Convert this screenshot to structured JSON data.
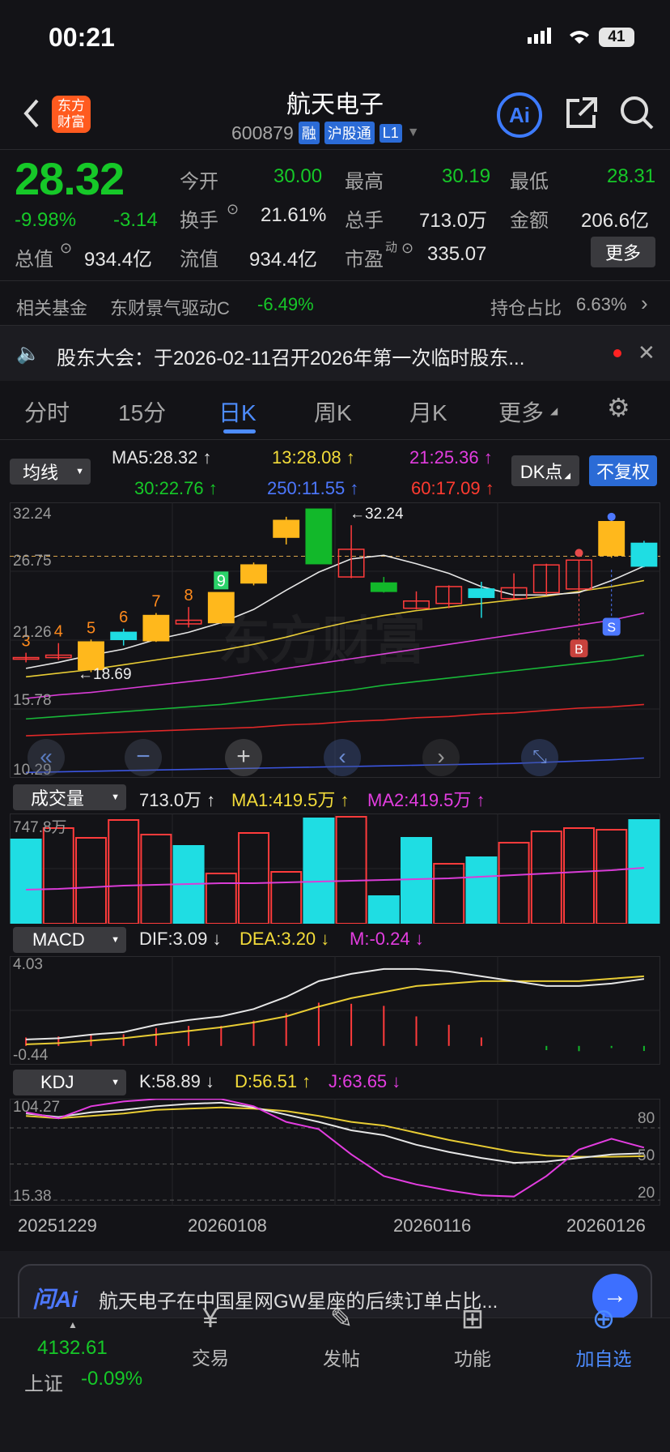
{
  "status": {
    "time": "00:21",
    "battery": "41"
  },
  "header": {
    "logo": "东方\n财富",
    "title": "航天电子",
    "code": "600879",
    "tags": [
      "融",
      "沪股通",
      "L1"
    ],
    "ai": "Ai"
  },
  "quote": {
    "price": "28.32",
    "change_pct": "-9.98%",
    "change": "-3.14",
    "open_label": "今开",
    "open": "30.00",
    "high_label": "最高",
    "high": "30.19",
    "low_label": "最低",
    "low": "28.31",
    "turnover_label": "换手",
    "turnover": "21.61%",
    "vol_label": "总手",
    "vol": "713.0万",
    "amount_label": "金额",
    "amount": "206.6亿",
    "mcap_label": "总值",
    "mcap": "934.4亿",
    "float_label": "流值",
    "float": "934.4亿",
    "pe_label": "市盈",
    "pe_sup": "动",
    "pe": "335.07",
    "more": "更多"
  },
  "fund": {
    "label": "相关基金",
    "name": "东财景气驱动C",
    "pct": "-6.49%",
    "hold_label": "持仓占比",
    "hold": "6.63%"
  },
  "notice": {
    "text": "股东大会：于2026-02-11召开2026年第一次临时股东..."
  },
  "tabs": [
    "分时",
    "15分",
    "日K",
    "周K",
    "月K",
    "更多"
  ],
  "ma": {
    "sel": "均线",
    "ma5": "MA5:28.32",
    "ma13": "13:28.08",
    "ma21": "21:25.36",
    "ma30": "30:22.76",
    "ma250": "250:11.55",
    "ma60": "60:17.09",
    "dk": "DK点",
    "fq": "不复权"
  },
  "kaxis": [
    "32.24",
    "26.75",
    "21.26",
    "15.78",
    "10.29"
  ],
  "kmarks": {
    "high": "32.24",
    "low": "18.69",
    "B": "B",
    "S": "S",
    "watermark": "东方财富"
  },
  "vol": {
    "sel": "成交量",
    "v": "713.0万",
    "ma1": "MA1:419.5万",
    "ma2": "MA2:419.5万",
    "max": "747.8万"
  },
  "macd": {
    "sel": "MACD",
    "dif": "DIF:3.09",
    "dea": "DEA:3.20",
    "m": "M:-0.24",
    "top": "4.03",
    "bottom": "-0.44"
  },
  "kdj": {
    "sel": "KDJ",
    "k": "K:58.89",
    "d": "D:56.51",
    "j": "J:63.65",
    "top": "104.27",
    "bottom": "15.38",
    "l80": "80",
    "l50": "50",
    "l20": "20"
  },
  "dates": [
    "20251229",
    "20260108",
    "20260116",
    "20260126"
  ],
  "ask": {
    "brand": "问Ai",
    "text": "航天电子在中国星网GW星座的后续订单占比..."
  },
  "nav": {
    "index_val": "4132.61",
    "index_name": "上证",
    "index_pct": "-0.09%",
    "items": [
      "交易",
      "发帖",
      "功能",
      "加自选"
    ]
  },
  "chart_data": {
    "type": "candlestick",
    "candles": [
      {
        "o": 19.9,
        "c": 19.9,
        "h": 20.3,
        "l": 19.5,
        "color": "red"
      },
      {
        "o": 19.9,
        "c": 20.1,
        "h": 21.1,
        "l": 19.7,
        "color": "red"
      },
      {
        "o": 18.9,
        "c": 21.2,
        "h": 21.4,
        "l": 18.69,
        "color": "yellow"
      },
      {
        "o": 22.0,
        "c": 21.4,
        "h": 22.3,
        "l": 20.9,
        "color": "cyan"
      },
      {
        "o": 21.3,
        "c": 23.4,
        "h": 23.6,
        "l": 21.2,
        "color": "yellow"
      },
      {
        "o": 22.7,
        "c": 23.0,
        "h": 24.1,
        "l": 22.4,
        "color": "red"
      },
      {
        "o": 22.8,
        "c": 25.3,
        "h": 25.3,
        "l": 22.7,
        "color": "yellow"
      },
      {
        "o": 26.1,
        "c": 27.6,
        "h": 27.8,
        "l": 25.9,
        "color": "yellow"
      },
      {
        "o": 29.9,
        "c": 31.3,
        "h": 31.6,
        "l": 29.3,
        "color": "yellow"
      },
      {
        "o": 32.24,
        "c": 27.7,
        "h": 32.24,
        "l": 27.7,
        "color": "green"
      },
      {
        "o": 26.6,
        "c": 28.9,
        "h": 30.9,
        "l": 26.5,
        "color": "red"
      },
      {
        "o": 26.1,
        "c": 25.4,
        "h": 26.6,
        "l": 25.3,
        "color": "green"
      },
      {
        "o": 24.0,
        "c": 24.6,
        "h": 25.4,
        "l": 23.9,
        "color": "red"
      },
      {
        "o": 24.4,
        "c": 25.8,
        "h": 25.9,
        "l": 24.0,
        "color": "red"
      },
      {
        "o": 25.6,
        "c": 24.9,
        "h": 26.2,
        "l": 23.2,
        "color": "cyan"
      },
      {
        "o": 24.8,
        "c": 25.7,
        "h": 26.9,
        "l": 24.7,
        "color": "red"
      },
      {
        "o": 25.3,
        "c": 27.6,
        "h": 27.7,
        "l": 25.1,
        "color": "red"
      },
      {
        "o": 25.6,
        "c": 28.0,
        "h": 28.0,
        "l": 25.5,
        "color": "red"
      },
      {
        "o": 28.4,
        "c": 31.2,
        "h": 31.3,
        "l": 28.2,
        "color": "yellow"
      },
      {
        "o": 27.5,
        "c": 29.4,
        "h": 29.6,
        "l": 27.4,
        "color": "cyan"
      }
    ],
    "ma5": [
      19.0,
      19.5,
      20.1,
      20.6,
      21.4,
      22.0,
      22.8,
      23.9,
      25.5,
      27.0,
      28.1,
      28.4,
      27.7,
      26.9,
      25.8,
      25.1,
      25.1,
      25.3,
      26.3,
      27.5
    ],
    "ma13": [
      18.3,
      18.6,
      18.9,
      19.3,
      19.7,
      20.1,
      20.5,
      21.0,
      21.6,
      22.3,
      22.9,
      23.4,
      23.8,
      24.1,
      24.4,
      24.7,
      25.0,
      25.4,
      25.8,
      26.3
    ],
    "ma21": [
      16.5,
      16.8,
      17.0,
      17.3,
      17.6,
      17.9,
      18.2,
      18.6,
      19.0,
      19.4,
      19.8,
      20.2,
      20.6,
      21.0,
      21.4,
      21.8,
      22.2,
      22.6,
      23.0,
      23.6
    ],
    "ma30": [
      14.8,
      15.0,
      15.2,
      15.4,
      15.6,
      15.8,
      16.0,
      16.3,
      16.6,
      16.9,
      17.2,
      17.6,
      17.9,
      18.2,
      18.5,
      18.8,
      19.1,
      19.4,
      19.7,
      20.1
    ],
    "ma60": [
      13.4,
      13.5,
      13.6,
      13.7,
      13.8,
      13.9,
      14.0,
      14.1,
      14.3,
      14.4,
      14.6,
      14.7,
      14.9,
      15.0,
      15.2,
      15.3,
      15.5,
      15.7,
      15.8,
      16.0
    ],
    "ma250": [
      10.35,
      10.4,
      10.45,
      10.5,
      10.55,
      10.6,
      10.65,
      10.7,
      10.75,
      10.8,
      10.85,
      10.9,
      10.95,
      11.0,
      11.05,
      11.1,
      11.2,
      11.3,
      11.4,
      11.55
    ],
    "volumes": [
      520,
      590,
      530,
      640,
      550,
      480,
      310,
      560,
      320,
      650,
      660,
      170,
      530,
      370,
      410,
      500,
      570,
      590,
      580,
      640
    ],
    "vol_colors": [
      "cyan",
      "red",
      "red",
      "red",
      "red",
      "cyan",
      "red",
      "red",
      "red",
      "cyan",
      "red",
      "cyan",
      "cyan",
      "red",
      "cyan",
      "red",
      "red",
      "red",
      "red",
      "cyan"
    ],
    "vol_ma": [
      210,
      215,
      225,
      235,
      240,
      245,
      250,
      250,
      255,
      260,
      265,
      270,
      275,
      280,
      290,
      300,
      310,
      320,
      330,
      345
    ],
    "dif": [
      0.6,
      0.65,
      0.8,
      0.9,
      1.2,
      1.4,
      1.55,
      1.85,
      2.35,
      3.0,
      3.3,
      3.5,
      3.5,
      3.4,
      3.2,
      3.0,
      2.8,
      2.8,
      2.9,
      3.09
    ],
    "dea": [
      0.4,
      0.45,
      0.55,
      0.65,
      0.8,
      0.95,
      1.1,
      1.3,
      1.55,
      1.95,
      2.3,
      2.55,
      2.8,
      2.9,
      3.0,
      3.0,
      3.0,
      3.0,
      3.1,
      3.2
    ],
    "macd": [
      0.4,
      0.45,
      0.55,
      0.55,
      0.85,
      0.95,
      0.95,
      1.2,
      1.55,
      2.05,
      2.0,
      1.9,
      1.4,
      1.0,
      0.4,
      0.0,
      -0.2,
      -0.25,
      -0.1,
      -0.24
    ],
    "k": [
      92,
      89,
      93,
      95,
      98,
      100,
      101,
      97,
      91,
      85,
      78,
      74,
      66,
      60,
      55,
      51,
      52,
      55,
      58,
      58.89
    ],
    "d": [
      90,
      88,
      90,
      92,
      95,
      96,
      97,
      96,
      94,
      90,
      85,
      82,
      76,
      70,
      65,
      60,
      57,
      56,
      56,
      56.51
    ],
    "j": [
      93,
      88,
      98,
      102,
      104,
      104,
      104,
      98,
      85,
      79,
      58,
      40,
      33,
      28,
      24,
      23,
      40,
      62,
      71,
      63.65
    ]
  }
}
